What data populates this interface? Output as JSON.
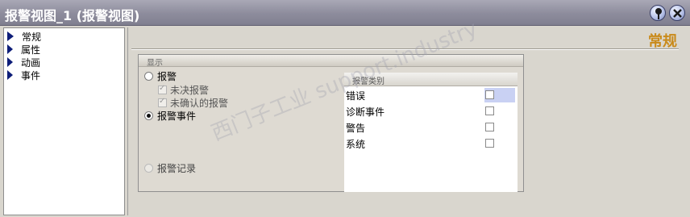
{
  "window": {
    "title": "报警视图_1 (报警视图)"
  },
  "nav": {
    "items": [
      {
        "label": "常规"
      },
      {
        "label": "属性"
      },
      {
        "label": "动画"
      },
      {
        "label": "事件"
      }
    ]
  },
  "main": {
    "title": "常规",
    "group": {
      "title": "显示",
      "radio_alarm": "报警",
      "chk_unack_alarm": "未决报警",
      "chk_unconfirmed": "未确认的报警",
      "radio_event": "报警事件",
      "radio_log": "报警记录",
      "category_header": "报警类别",
      "categories": [
        {
          "name": "错误"
        },
        {
          "name": "诊断事件"
        },
        {
          "name": "警告"
        },
        {
          "name": "系统"
        }
      ]
    }
  },
  "colors": {
    "title_accent": "#c98a1a",
    "nav_arrow": "#0d1d78"
  },
  "watermark": "西门子工业 support.industry"
}
